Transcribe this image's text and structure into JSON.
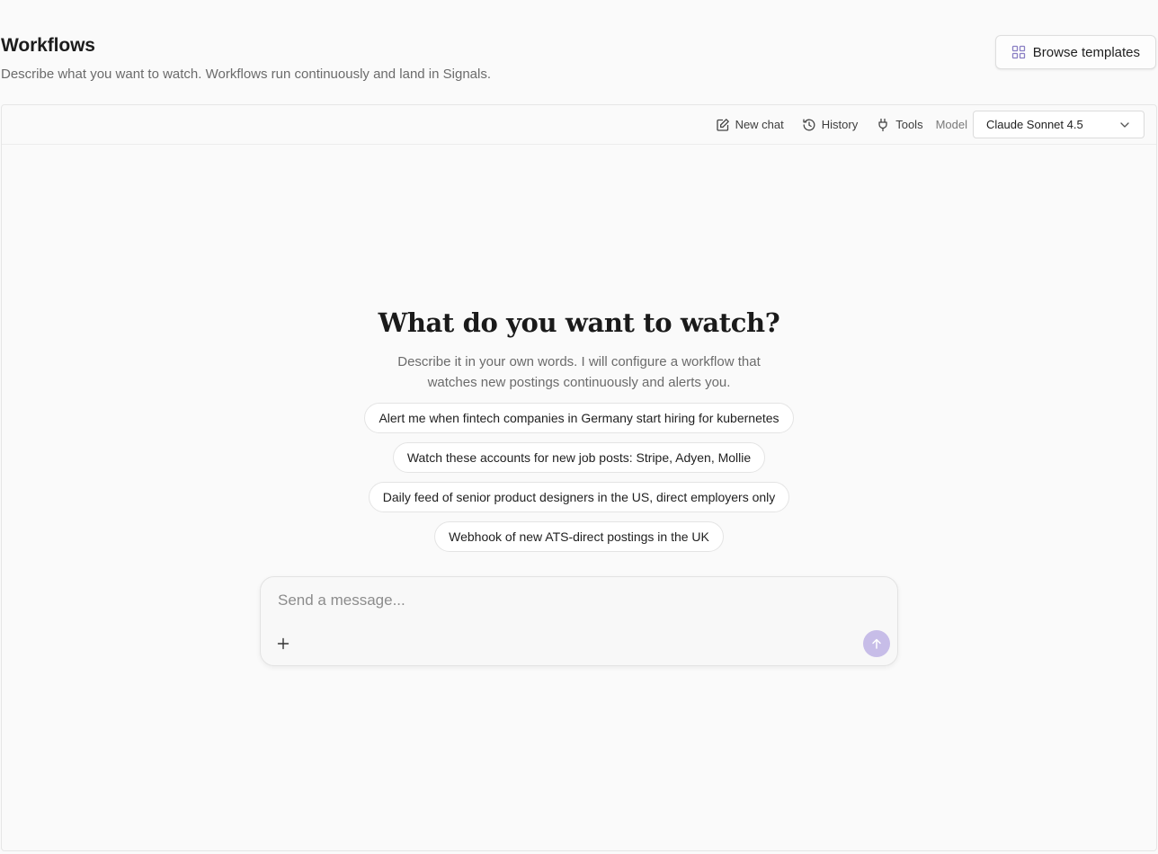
{
  "header": {
    "title": "Workflows",
    "subtitle": "Describe what you want to watch. Workflows run continuously and land in Signals.",
    "browse_templates_label": "Browse templates"
  },
  "toolbar": {
    "new_chat_label": "New chat",
    "history_label": "History",
    "tools_label": "Tools",
    "model_label": "Model",
    "model_selected": "Claude Sonnet 4.5"
  },
  "hero": {
    "title": "What do you want to watch?",
    "description": "Describe it in your own words. I will configure a workflow that watches new postings continuously and alerts you."
  },
  "suggestions": [
    "Alert me when fintech companies in Germany start hiring for kubernetes",
    "Watch these accounts for new job posts: Stripe, Adyen, Mollie",
    "Daily feed of senior product designers in the US, direct employers only",
    "Webhook of new ATS-direct postings in the UK"
  ],
  "composer": {
    "placeholder": "Send a message..."
  },
  "colors": {
    "accent": "#c7bde8",
    "icon_accent": "#8a7fc4",
    "background": "#fafafa"
  },
  "icons": {
    "browse_templates": "grid-icon",
    "new_chat": "edit-square-icon",
    "history": "history-icon",
    "tools": "plug-icon",
    "model_select": "chevron-down-icon",
    "attach": "plus-icon",
    "send": "arrow-up-icon"
  }
}
